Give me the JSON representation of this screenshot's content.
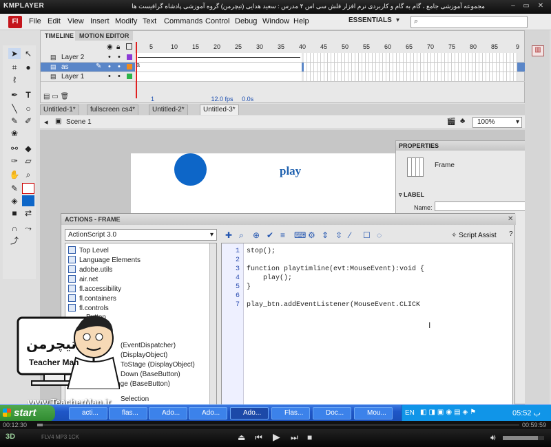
{
  "player": {
    "logo": "KMPLAYER",
    "caption": "مجموعه آموزشی جامع ، گام به گام و کاربردی نرم افزار فلش سی اس ۴ مدرس : سعید هدایی (تیچرمن) گروه آموزشی پادشاه گرافیست ها",
    "window_buttons": [
      "–",
      "▭",
      "✕"
    ],
    "time_elapsed": "00:12:30",
    "time_total": "00:59:59",
    "badge": "3D",
    "formats": "FLV4  MP3  1CK"
  },
  "flash": {
    "logo": "Fl",
    "menu": [
      "File",
      "Edit",
      "View",
      "Insert",
      "Modify",
      "Text",
      "Commands",
      "Control",
      "Debug",
      "Window",
      "Help"
    ],
    "workspace": "ESSENTIALS"
  },
  "timeline": {
    "tabs": [
      "TIMELINE",
      "MOTION EDITOR"
    ],
    "layers": [
      {
        "name": "Layer 2"
      },
      {
        "name": "as"
      },
      {
        "name": "Layer 1"
      }
    ],
    "ruler": [
      "5",
      "10",
      "15",
      "20",
      "25",
      "30",
      "35",
      "40",
      "45",
      "50",
      "55",
      "60",
      "65",
      "70",
      "75",
      "80",
      "85",
      "90",
      "9"
    ],
    "status_frame": "1",
    "status_fps": "12.0 fps",
    "status_time": "0.0s"
  },
  "documents": {
    "tabs": [
      "Untitled-1*",
      "fullscreen cs4*",
      "Untitled-2*",
      "Untitled-3*"
    ],
    "active": "Untitled-3*"
  },
  "scene": {
    "label": "Scene 1",
    "zoom": "100%"
  },
  "stage": {
    "button_text": "play",
    "circle_color": "#0d66c8"
  },
  "properties": {
    "title": "PROPERTIES",
    "type": "Frame",
    "section": "LABEL",
    "name_label": "Name:"
  },
  "actions": {
    "title": "ACTIONS - FRAME",
    "version": "ActionScript 3.0",
    "script_assist": "Script Assist",
    "tree": [
      "Top Level",
      "Language Elements",
      "adobe.utils",
      "air.net",
      "fl.accessibility",
      "fl.containers",
      "fl.controls"
    ],
    "tree_lower": [
      "Button",
      "(EventDispatcher)",
      "(DisplayObject)",
      "ToStage (DisplayObject)",
      "Down (BaseButton)",
      "change (BaseButton)",
      "Selection"
    ],
    "code": [
      {
        "n": "1",
        "text": "stop();"
      },
      {
        "n": "2",
        "text": ""
      },
      {
        "n": "3",
        "text": "function playtimline(evt:MouseEvent):void {"
      },
      {
        "n": "4",
        "text": "    play();"
      },
      {
        "n": "5",
        "text": "}"
      },
      {
        "n": "6",
        "text": ""
      },
      {
        "n": "7",
        "text": "play_btn.addEventListener(MouseEvent.CLICK"
      }
    ]
  },
  "watermark": {
    "name_fa": "تیچرمن",
    "name_en": "Teacher Man",
    "site": "www.TeacherMan.ir"
  },
  "taskbar": {
    "start": "start",
    "tasks": [
      "acti...",
      "flas...",
      "Ado...",
      "Ado...",
      "Ado...",
      "Flas...",
      "Doc...",
      "Mou..."
    ],
    "lang": "EN",
    "clock": "05:52 ب"
  }
}
